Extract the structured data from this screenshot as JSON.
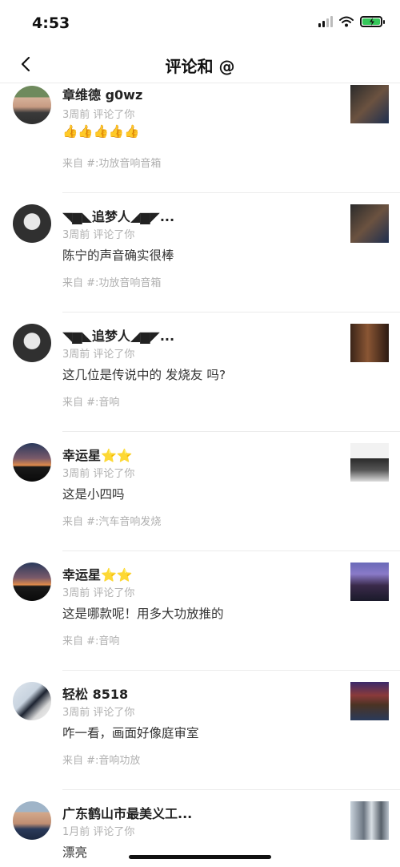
{
  "status": {
    "time": "4:53"
  },
  "nav": {
    "title": "评论和 @"
  },
  "comments": [
    {
      "name": "章维德 g0wz",
      "meta": "3周前 评论了你",
      "content": "👍👍👍👍👍",
      "source": "来自 #:功放音响音箱"
    },
    {
      "name": "◥▆◣追梦人◢▆◤...",
      "meta": "3周前 评论了你",
      "content": "陈宁的声音确实很棒",
      "source": "来自 #:功放音响音箱"
    },
    {
      "name": "◥▆◣追梦人◢▆◤...",
      "meta": "3周前 评论了你",
      "content": "这几位是传说中的 发烧友 吗?",
      "source": "来自 #:音响"
    },
    {
      "name": "幸运星⭐⭐",
      "meta": "3周前 评论了你",
      "content": "这是小四吗",
      "source": "来自 #:汽车音响发烧"
    },
    {
      "name": "幸运星⭐⭐",
      "meta": "3周前 评论了你",
      "content": "这是哪款呢！用多大功放推的",
      "source": "来自 #:音响"
    },
    {
      "name": "轻松 8518",
      "meta": "3周前 评论了你",
      "content": "咋一看，画面好像庭审室",
      "source": "来自 #:音响功放"
    },
    {
      "name": "广东鹤山市最美义工...",
      "meta": "1月前 评论了你",
      "content": "漂亮",
      "source": ""
    }
  ]
}
